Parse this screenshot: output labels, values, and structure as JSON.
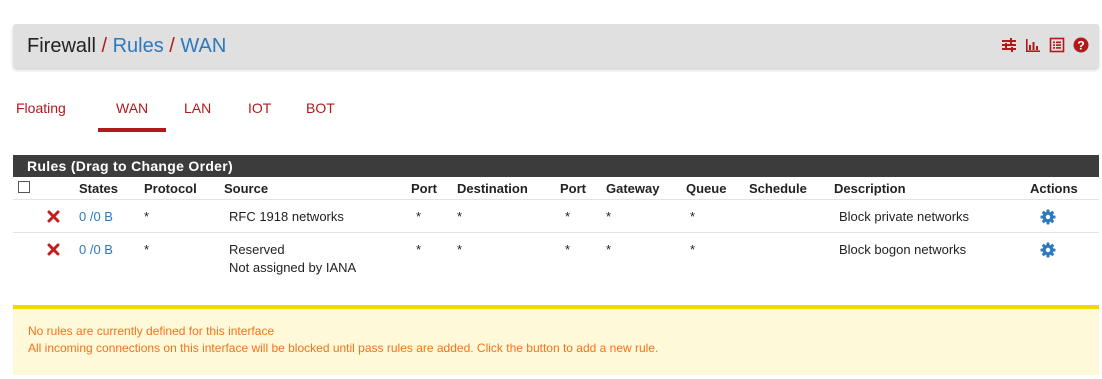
{
  "breadcrumb": {
    "root": "Firewall",
    "sep1": "/",
    "item1": "Rules",
    "sep2": "/",
    "item2": "WAN"
  },
  "header_icons": [
    "sliders-icon",
    "bar-chart-icon",
    "list-icon",
    "help-icon"
  ],
  "tabs": [
    {
      "label": "Floating",
      "active": false
    },
    {
      "label": "WAN",
      "active": true
    },
    {
      "label": "LAN",
      "active": false
    },
    {
      "label": "IOT",
      "active": false
    },
    {
      "label": "BOT",
      "active": false
    }
  ],
  "panel": {
    "title": "Rules (Drag to Change Order)"
  },
  "columns": {
    "states": "States",
    "protocol": "Protocol",
    "source": "Source",
    "port": "Port",
    "destination": "Destination",
    "port2": "Port",
    "gateway": "Gateway",
    "queue": "Queue",
    "schedule": "Schedule",
    "description": "Description",
    "actions": "Actions"
  },
  "rules": [
    {
      "states": "0 /0 B",
      "protocol": "*",
      "source": "RFC 1918 networks",
      "source_sub": "",
      "port": "*",
      "destination": "*",
      "port2": "*",
      "gateway": "*",
      "queue": "*",
      "schedule": "",
      "description": "Block private networks"
    },
    {
      "states": "0 /0 B",
      "protocol": "*",
      "source": "Reserved",
      "source_sub": "Not assigned by IANA",
      "port": "*",
      "destination": "*",
      "port2": "*",
      "gateway": "*",
      "queue": "*",
      "schedule": "",
      "description": "Block bogon networks"
    }
  ],
  "notice": {
    "line1": "No rules are currently defined for this interface",
    "line2": "All incoming connections on this interface will be blocked until pass rules are added. Click the button to add a new rule."
  },
  "colors": {
    "accent_red": "#b11a1a",
    "link_blue": "#2d79bf",
    "panel_dark": "#3c3c3c",
    "notice_bg": "#fdf9d9",
    "notice_text": "#f5731a",
    "notice_border": "#f4d600"
  }
}
